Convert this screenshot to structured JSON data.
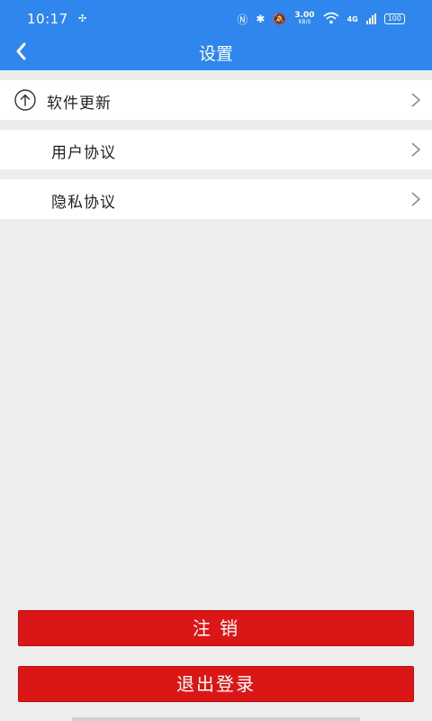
{
  "status_bar": {
    "time": "10:17",
    "speed_value": "3.00",
    "speed_unit": "KB/S",
    "network": "4G",
    "battery": "100"
  },
  "app_bar": {
    "title": "设置"
  },
  "settings": {
    "items": [
      {
        "label": "软件更新",
        "icon": "upload-arrow-icon"
      },
      {
        "label": "用户协议"
      },
      {
        "label": "隐私协议"
      }
    ]
  },
  "actions": {
    "deregister_label": "注 销",
    "logout_label": "退出登录"
  },
  "colors": {
    "primary_blue": "#2f86ec",
    "danger_red": "#db1616",
    "background": "#ededed"
  }
}
